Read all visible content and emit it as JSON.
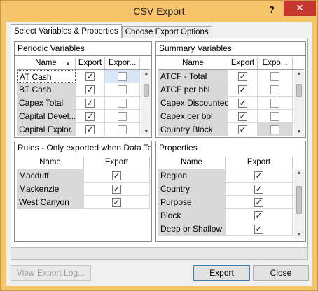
{
  "window": {
    "title": "CSV Export",
    "help_label": "?",
    "close_label": "✕"
  },
  "tabs": [
    {
      "label": "Select Variables & Properties",
      "active": true
    },
    {
      "label": "Choose Export Options",
      "active": false
    }
  ],
  "periodic": {
    "title": "Periodic Variables",
    "columns": [
      "Name",
      "Export",
      "Expor..."
    ],
    "rows": [
      {
        "name": "AT Cash",
        "export": true,
        "export2": false
      },
      {
        "name": "BT Cash",
        "export": true,
        "export2": false
      },
      {
        "name": "Capex Total",
        "export": true,
        "export2": false
      },
      {
        "name": "Capital Devel...",
        "export": true,
        "export2": false
      },
      {
        "name": "Capital Explor...",
        "export": true,
        "export2": false
      }
    ]
  },
  "summary": {
    "title": "Summary Variables",
    "columns": [
      "Name",
      "Export",
      "Expo..."
    ],
    "rows": [
      {
        "name": "ATCF - Total",
        "export": true,
        "export2": false
      },
      {
        "name": "ATCF per bbl",
        "export": true,
        "export2": false
      },
      {
        "name": "Capex Discounted",
        "export": true,
        "export2": false
      },
      {
        "name": "Capex per bbl",
        "export": true,
        "export2": false
      },
      {
        "name": "Country Block",
        "export": true,
        "export2": false
      }
    ]
  },
  "rules": {
    "title": "Rules - Only exported when Data Table",
    "columns": [
      "Name",
      "Export"
    ],
    "rows": [
      {
        "name": "Macduff",
        "export": true
      },
      {
        "name": "Mackenzie",
        "export": true
      },
      {
        "name": "West Canyon",
        "export": true
      }
    ]
  },
  "properties": {
    "title": "Properties",
    "columns": [
      "Name",
      "Export"
    ],
    "rows": [
      {
        "name": "Region",
        "export": true
      },
      {
        "name": "Country",
        "export": true
      },
      {
        "name": "Purpose",
        "export": true
      },
      {
        "name": "Block",
        "export": true
      },
      {
        "name": "Deep or Shallow",
        "export": true
      }
    ]
  },
  "buttons": {
    "view_log": "View Export Log...",
    "export": "Export",
    "close": "Close"
  }
}
